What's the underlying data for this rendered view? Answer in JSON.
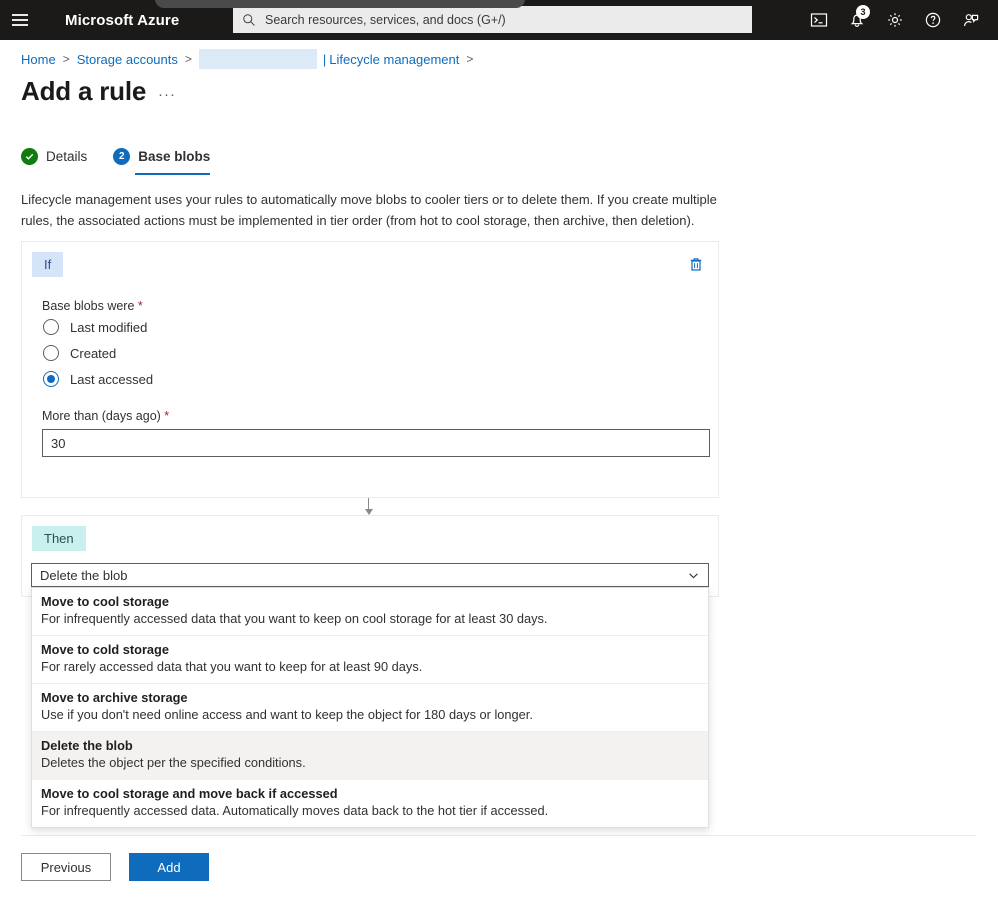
{
  "header": {
    "menu_icon": "hamburger-icon",
    "brand": "Microsoft Azure",
    "search": {
      "placeholder": "Search resources, services, and docs (G+/)",
      "value": "",
      "icon": "search-icon"
    },
    "icons": [
      {
        "name": "cloud-shell-icon",
        "label": "Cloud Shell"
      },
      {
        "name": "notifications-icon",
        "label": "Notifications",
        "badge": "3"
      },
      {
        "name": "settings-gear-icon",
        "label": "Settings"
      },
      {
        "name": "help-icon",
        "label": "Help"
      },
      {
        "name": "feedback-icon",
        "label": "Feedback"
      }
    ]
  },
  "breadcrumb": {
    "home": "Home",
    "storage_accounts": "Storage accounts",
    "account_redacted": "",
    "pipe": "|",
    "lifecycle": "Lifecycle management",
    "separator": ">"
  },
  "page": {
    "title": "Add a rule",
    "ellipsis": "···"
  },
  "tabs": [
    {
      "label": "Details",
      "state": "completed",
      "badge": "✓"
    },
    {
      "label": "Base blobs",
      "state": "active",
      "badge": "2"
    }
  ],
  "description": "Lifecycle management uses your rules to automatically move blobs to cooler tiers or to delete them. If you create multiple rules, the associated actions must be implemented in tier order (from hot to cool storage, then archive, then deletion).",
  "if_card": {
    "tag": "If",
    "delete_icon": "trash-icon",
    "field_label": "Base blobs were",
    "required_mark": "*",
    "radios": [
      {
        "label": "Last modified",
        "checked": false
      },
      {
        "label": "Created",
        "checked": false
      },
      {
        "label": "Last accessed",
        "checked": true
      }
    ],
    "days_label": "More than (days ago)",
    "days_required_mark": "*",
    "days_value": "30",
    "days_placeholder": ""
  },
  "then_card": {
    "tag": "Then",
    "selected_action": "Delete the blob",
    "chevron_icon": "chevron-down-icon",
    "options": [
      {
        "title": "Move to cool storage",
        "description": "For infrequently accessed data that you want to keep on cool storage for at least 30 days.",
        "selected": false
      },
      {
        "title": "Move to cold storage",
        "description": "For rarely accessed data that you want to keep for at least 90 days.",
        "selected": false
      },
      {
        "title": "Move to archive storage",
        "description": "Use if you don't need online access and want to keep the object for 180 days or longer.",
        "selected": false
      },
      {
        "title": "Delete the blob",
        "description": "Deletes the object per the specified conditions.",
        "selected": true
      },
      {
        "title": "Move to cool storage and move back if accessed",
        "description": "For infrequently accessed data. Automatically moves data back to the hot tier if accessed.",
        "selected": false
      }
    ]
  },
  "footer": {
    "previous_label": "Previous",
    "add_label": "Add"
  },
  "colors": {
    "accent": "#0f6cbd",
    "header_bg": "#1b1a19",
    "if_tag_bg": "#d6e4fa",
    "then_tag_bg": "#c9f0ef",
    "success": "#107c10",
    "required": "#a4262c",
    "selected_row": "#f3f2f1"
  }
}
